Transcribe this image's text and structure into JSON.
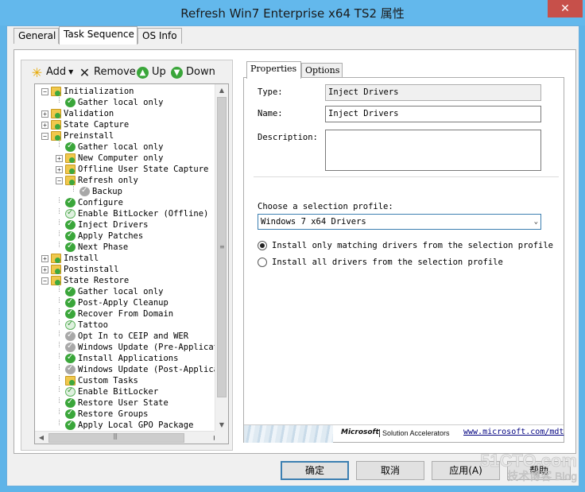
{
  "window": {
    "title": "Refresh Win7 Enterprise x64 TS2 属性",
    "close_label": "✕"
  },
  "main_tabs": [
    {
      "label": "General"
    },
    {
      "label": "Task Sequence"
    },
    {
      "label": "OS Info"
    }
  ],
  "toolbar": {
    "add": "Add",
    "remove": "Remove",
    "up": "Up",
    "down": "Down"
  },
  "tree": [
    {
      "label": "Initialization",
      "icon": "folder",
      "depth": 0,
      "expander": "−"
    },
    {
      "label": "Gather local only",
      "icon": "check-green",
      "depth": 1
    },
    {
      "label": "Validation",
      "icon": "folder",
      "depth": 0,
      "expander": "+"
    },
    {
      "label": "State Capture",
      "icon": "folder",
      "depth": 0,
      "expander": "+"
    },
    {
      "label": "Preinstall",
      "icon": "folder",
      "depth": 0,
      "expander": "−"
    },
    {
      "label": "Gather local only",
      "icon": "check-green",
      "depth": 1
    },
    {
      "label": "New Computer only",
      "icon": "folder",
      "depth": 1,
      "expander": "+"
    },
    {
      "label": "Offline User State Capture",
      "icon": "folder",
      "depth": 1,
      "expander": "+"
    },
    {
      "label": "Refresh only",
      "icon": "folder",
      "depth": 1,
      "expander": "−"
    },
    {
      "label": "Backup",
      "icon": "check-grey",
      "depth": 2
    },
    {
      "label": "Configure",
      "icon": "check-green",
      "depth": 1
    },
    {
      "label": "Enable BitLocker (Offline)",
      "icon": "check-light",
      "depth": 1
    },
    {
      "label": "Inject Drivers",
      "icon": "check-green",
      "depth": 1
    },
    {
      "label": "Apply Patches",
      "icon": "check-green",
      "depth": 1
    },
    {
      "label": "Next Phase",
      "icon": "check-green",
      "depth": 1
    },
    {
      "label": "Install",
      "icon": "folder",
      "depth": 0,
      "expander": "+"
    },
    {
      "label": "Postinstall",
      "icon": "folder",
      "depth": 0,
      "expander": "+"
    },
    {
      "label": "State Restore",
      "icon": "folder",
      "depth": 0,
      "expander": "−"
    },
    {
      "label": "Gather local only",
      "icon": "check-green",
      "depth": 1
    },
    {
      "label": "Post-Apply Cleanup",
      "icon": "check-green",
      "depth": 1
    },
    {
      "label": "Recover From Domain",
      "icon": "check-green",
      "depth": 1
    },
    {
      "label": "Tattoo",
      "icon": "check-light",
      "depth": 1
    },
    {
      "label": "Opt In to CEIP and WER",
      "icon": "check-grey",
      "depth": 1
    },
    {
      "label": "Windows Update (Pre-Applicatio",
      "icon": "check-grey",
      "depth": 1
    },
    {
      "label": "Install Applications",
      "icon": "check-green",
      "depth": 1
    },
    {
      "label": "Windows Update (Post-Applicati",
      "icon": "check-grey",
      "depth": 1
    },
    {
      "label": "Custom Tasks",
      "icon": "folder",
      "depth": 1
    },
    {
      "label": "Enable BitLocker",
      "icon": "check-light",
      "depth": 1
    },
    {
      "label": "Restore User State",
      "icon": "check-green",
      "depth": 1
    },
    {
      "label": "Restore Groups",
      "icon": "check-green",
      "depth": 1
    },
    {
      "label": "Apply Local GPO Package",
      "icon": "check-green",
      "depth": 1
    }
  ],
  "right_tabs": [
    {
      "label": "Properties"
    },
    {
      "label": "Options"
    }
  ],
  "properties": {
    "type_label": "Type:",
    "type_value": "Inject Drivers",
    "name_label": "Name:",
    "name_value": "Inject Drivers",
    "description_label": "Description:",
    "description_value": "",
    "profile_label": "Choose a selection profile:",
    "profile_value": "Windows 7 x64 Drivers",
    "radio_matching": "Install only matching drivers from the selection profile",
    "radio_all": "Install all drivers from the selection profile",
    "radio_matching_selected": true
  },
  "banner": {
    "microsoft": "Microsoft",
    "solution": "Solution Accelerators",
    "link": "www.microsoft.com/mdt"
  },
  "buttons": {
    "ok": "确定",
    "cancel": "取消",
    "apply": "应用(A)",
    "help": "帮助"
  },
  "watermark": {
    "site": "51CTO.com",
    "tagline": "技术博客 Blog"
  },
  "colors": {
    "title_bar": "#63b8ec",
    "close_button": "#c7504a",
    "selection_border": "#3c7fb1",
    "green_check": "#3aa63a",
    "folder": "#f0c84c"
  }
}
